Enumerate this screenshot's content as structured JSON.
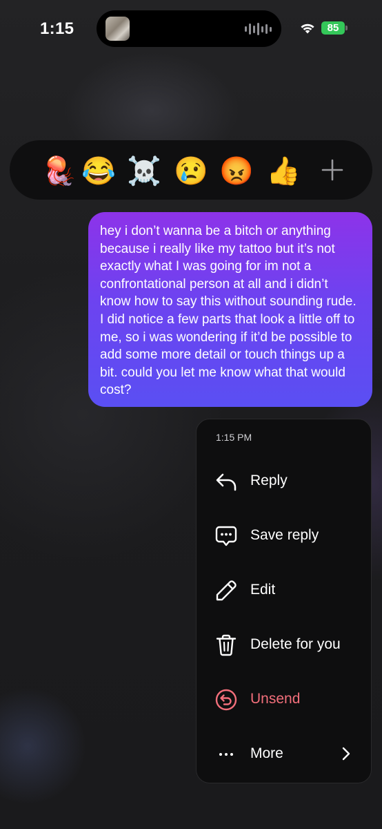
{
  "status_bar": {
    "time": "1:15",
    "battery": "85"
  },
  "reactions": {
    "emojis": [
      {
        "icon": "jellyfish",
        "glyph": "🪼"
      },
      {
        "icon": "face-with-tears-of-joy",
        "glyph": "😂"
      },
      {
        "icon": "skull-and-crossbones",
        "glyph": "☠️"
      },
      {
        "icon": "crying-face",
        "glyph": "😢"
      },
      {
        "icon": "angry-face",
        "glyph": "😡"
      },
      {
        "icon": "thumbs-up",
        "glyph": "👍"
      }
    ],
    "add_icon": "plus-icon"
  },
  "message": {
    "text": "hey i don’t wanna be a bitch or anything because i really like my tattoo but it’s not exactly what I was going for im not a confrontational person at all and i didn’t know how to say this without sounding rude. I did notice a few parts that look a little off to me, so i was wondering if it’d be possible to add some more detail or touch things up a bit. could you let me know what that would cost?",
    "bubble_colors": [
      "#8d33e9",
      "#5a4ff3"
    ]
  },
  "menu": {
    "timestamp": "1:15 PM",
    "items": [
      {
        "label": "Reply",
        "icon": "reply-arrow-icon"
      },
      {
        "label": "Save reply",
        "icon": "chat-bubble-dots-icon"
      },
      {
        "label": "Edit",
        "icon": "pencil-icon"
      },
      {
        "label": "Delete for you",
        "icon": "trash-icon"
      },
      {
        "label": "Unsend",
        "icon": "unsend-icon",
        "color": "#f26f7b"
      },
      {
        "label": "More",
        "icon": "ellipsis-icon",
        "trailing_icon": "chevron-right-icon"
      }
    ]
  }
}
